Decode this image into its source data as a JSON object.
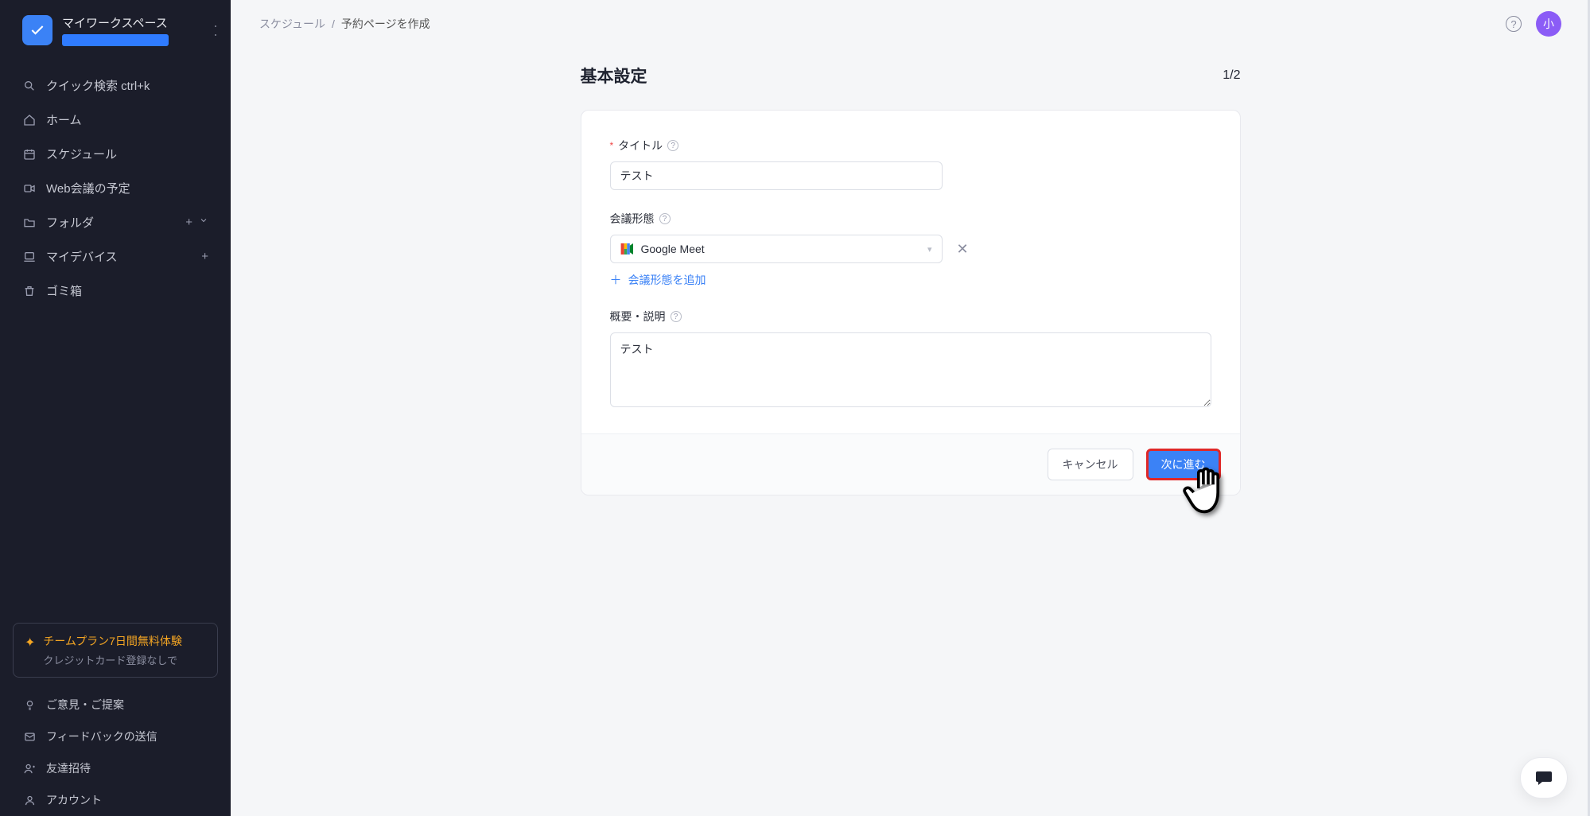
{
  "workspace": {
    "title": "マイワークスペース"
  },
  "sidebar": {
    "items": [
      {
        "label": "クイック検索 ctrl+k"
      },
      {
        "label": "ホーム"
      },
      {
        "label": "スケジュール"
      },
      {
        "label": "Web会議の予定"
      },
      {
        "label": "フォルダ"
      },
      {
        "label": "マイデバイス"
      },
      {
        "label": "ゴミ箱"
      }
    ],
    "trial": {
      "title": "チームプラン7日間無料体験",
      "sub": "クレジットカード登録なしで"
    },
    "footer": [
      {
        "label": "ご意見・ご提案"
      },
      {
        "label": "フィードバックの送信"
      },
      {
        "label": "友達招待"
      },
      {
        "label": "アカウント"
      }
    ]
  },
  "topbar": {
    "crumb1": "スケジュール",
    "crumb2": "予約ページを作成",
    "avatar": "小"
  },
  "page": {
    "title": "基本設定",
    "step": "1/2",
    "field_title_label": "タイトル",
    "field_title_value": "テスト",
    "field_meeting_label": "会議形態",
    "meeting_selected": "Google Meet",
    "add_meeting": "会議形態を追加",
    "field_desc_label": "概要・説明",
    "field_desc_value": "テスト",
    "btn_cancel": "キャンセル",
    "btn_next": "次に進む"
  }
}
